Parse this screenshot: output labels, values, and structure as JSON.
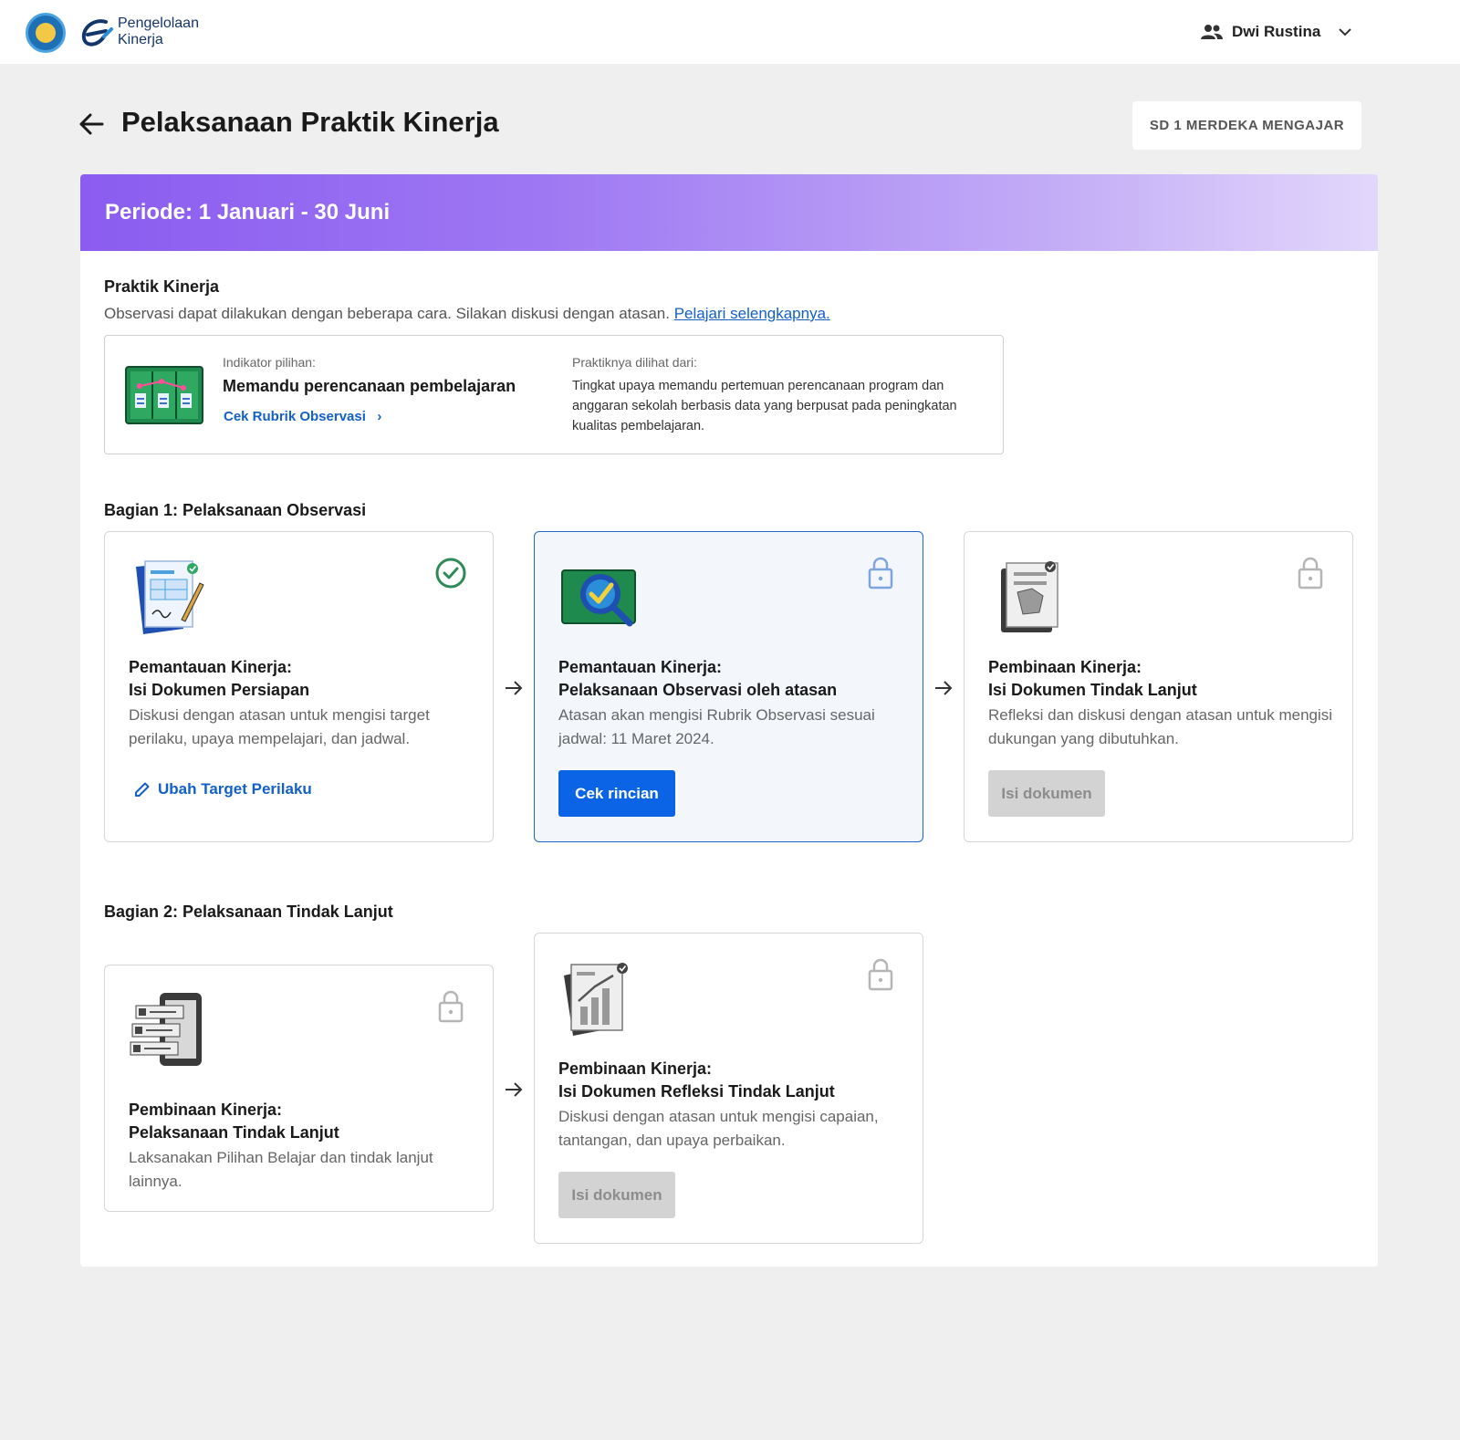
{
  "app": {
    "logo_line1": "Pengelolaan",
    "logo_line2": "Kinerja",
    "user_name": "Dwi Rustina"
  },
  "page": {
    "title": "Pelaksanaan Praktik Kinerja",
    "school": "SD 1 MERDEKA MENGAJAR",
    "period": "Periode: 1 Januari - 30 Juni"
  },
  "praktik": {
    "title": "Praktik Kinerja",
    "desc": "Observasi dapat dilakukan dengan beberapa cara. Silakan diskusi dengan atasan.",
    "learn_more": "Pelajari selengkapnya.",
    "indicator_label": "Indikator pilihan:",
    "indicator_value": "Memandu perencanaan pembelajaran",
    "rubric_link": "Cek Rubrik Observasi",
    "seen_label": "Praktiknya dilihat dari:",
    "seen_value": "Tingkat upaya memandu pertemuan perencanaan program dan anggaran sekolah berbasis data yang berpusat pada peningkatan kualitas pembelajaran."
  },
  "section1": {
    "title": "Bagian 1: Pelaksanaan Observasi",
    "steps": [
      {
        "title1": "Pemantauan Kinerja:",
        "title2": "Isi Dokumen Persiapan",
        "desc": "Diskusi dengan atasan untuk mengisi target perilaku, upaya mempelajari, dan jadwal.",
        "action": "Ubah Target Perilaku",
        "status": "completed"
      },
      {
        "title1": "Pemantauan Kinerja:",
        "title2": "Pelaksanaan Observasi oleh atasan",
        "desc": "Atasan akan mengisi Rubrik Observasi sesuai jadwal: 11 Maret 2024.",
        "action": "Cek rincian",
        "status": "active-locked"
      },
      {
        "title1": "Pembinaan Kinerja:",
        "title2": "Isi Dokumen Tindak Lanjut",
        "desc": "Refleksi dan diskusi dengan atasan untuk mengisi dukungan yang dibutuhkan.",
        "action": "Isi dokumen",
        "status": "locked"
      }
    ]
  },
  "section2": {
    "title": "Bagian 2: Pelaksanaan Tindak Lanjut",
    "steps": [
      {
        "title1": "Pembinaan Kinerja:",
        "title2": "Pelaksanaan Tindak Lanjut",
        "desc": "Laksanakan Pilihan Belajar dan tindak lanjut lainnya.",
        "status": "locked"
      },
      {
        "title1": "Pembinaan Kinerja:",
        "title2": "Isi Dokumen Refleksi Tindak Lanjut",
        "desc": "Diskusi dengan atasan untuk mengisi capaian, tantangan, dan upaya perbaikan.",
        "action": "Isi dokumen",
        "status": "locked"
      }
    ]
  },
  "colors": {
    "primary": "#0b64e5",
    "link": "#1260c8",
    "success": "#2e8b57",
    "lock_active": "#7ea6de",
    "lock_muted": "#b5b5b5",
    "period_start": "#8b5cf0",
    "period_end": "#e2d7fb"
  },
  "icons": {
    "back": "arrow-left-icon",
    "user": "users-icon",
    "chevron": "chevron-down-icon",
    "check": "check-circle-icon",
    "lock": "lock-icon",
    "pencil": "pencil-icon",
    "step_arrow": "arrow-right-icon"
  }
}
